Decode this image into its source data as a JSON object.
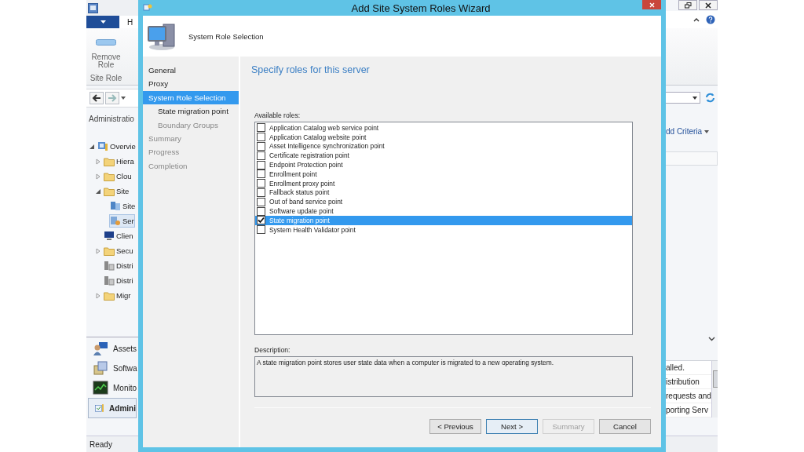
{
  "console": {
    "ribbon_tabs": [
      "H"
    ],
    "ribbon": {
      "button": "Remove Role",
      "group": "Site Role"
    },
    "navigation_header": "Administratio",
    "tree": [
      {
        "label": "Overvie",
        "kind": "overview",
        "selected": false,
        "expanded": true,
        "children": [
          {
            "label": "Hiera",
            "kind": "folder",
            "selected": false,
            "expanded": false
          },
          {
            "label": "Clou",
            "kind": "folder",
            "selected": false,
            "expanded": false
          },
          {
            "label": "Site",
            "kind": "folder",
            "selected": false,
            "expanded": true,
            "children": [
              {
                "label": "Site",
                "kind": "sites",
                "selected": false
              },
              {
                "label": "Ser",
                "kind": "roles",
                "selected": true
              }
            ]
          },
          {
            "label": "Clien",
            "kind": "computer",
            "selected": false
          },
          {
            "label": "Secu",
            "kind": "folder",
            "selected": false,
            "expanded": false
          },
          {
            "label": "Distri",
            "kind": "distribution",
            "selected": false
          },
          {
            "label": "Distri",
            "kind": "distribution",
            "selected": false
          },
          {
            "label": "Migr",
            "kind": "folder",
            "selected": false,
            "expanded": false
          }
        ]
      }
    ],
    "workspaces": [
      {
        "label": "Assets",
        "kind": "assets",
        "selected": false
      },
      {
        "label": "Softwa",
        "kind": "software",
        "selected": false
      },
      {
        "label": "Monito",
        "kind": "monitoring",
        "selected": false
      },
      {
        "label": "Admini",
        "kind": "administration",
        "selected": true
      }
    ],
    "status_bar": "Ready",
    "search_link": "dd Criteria",
    "detail_lines": [
      "alled.",
      "istribution",
      "requests and",
      "porting Serv"
    ]
  },
  "dialog": {
    "title": "Add Site System Roles Wizard",
    "header": "System Role Selection",
    "steps": [
      {
        "label": "General",
        "selected": false,
        "disabled": false
      },
      {
        "label": "Proxy",
        "selected": false,
        "disabled": false
      },
      {
        "label": "System Role Selection",
        "selected": true,
        "disabled": false,
        "children": [
          {
            "label": "State migration point",
            "selected": false,
            "disabled": false
          },
          {
            "label": "Boundary Groups",
            "selected": false,
            "disabled": true
          }
        ]
      },
      {
        "label": "Summary",
        "selected": false,
        "disabled": true
      },
      {
        "label": "Progress",
        "selected": false,
        "disabled": true
      },
      {
        "label": "Completion",
        "selected": false,
        "disabled": true
      }
    ],
    "page_title": "Specify roles for this server",
    "roles_label": "Available roles:",
    "roles": [
      {
        "label": "Application Catalog web service point",
        "checked": false,
        "selected": false
      },
      {
        "label": "Application Catalog website point",
        "checked": false,
        "selected": false
      },
      {
        "label": "Asset Intelligence synchronization point",
        "checked": false,
        "selected": false
      },
      {
        "label": "Certificate registration point",
        "checked": false,
        "selected": false
      },
      {
        "label": "Endpoint Protection point",
        "checked": false,
        "selected": false
      },
      {
        "label": "Enrollment point",
        "checked": false,
        "selected": false
      },
      {
        "label": "Enrollment proxy point",
        "checked": false,
        "selected": false
      },
      {
        "label": "Fallback status point",
        "checked": false,
        "selected": false
      },
      {
        "label": "Out of band service point",
        "checked": false,
        "selected": false
      },
      {
        "label": "Software update point",
        "checked": false,
        "selected": false
      },
      {
        "label": "State migration point",
        "checked": true,
        "selected": true
      },
      {
        "label": "System Health Validator point",
        "checked": false,
        "selected": false
      }
    ],
    "description_label": "Description:",
    "description": "A state migration point stores user state data when a computer is migrated to a new operating system.",
    "buttons": [
      {
        "label": "< Previous",
        "disabled": false,
        "default": false
      },
      {
        "label": "Next >",
        "disabled": false,
        "default": true
      },
      {
        "label": "Summary",
        "disabled": true,
        "default": false
      },
      {
        "label": "Cancel",
        "disabled": false,
        "default": false
      }
    ]
  }
}
